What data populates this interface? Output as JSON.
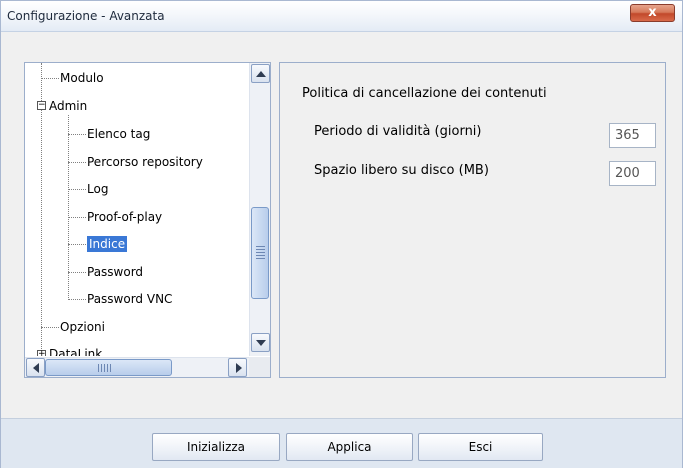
{
  "window": {
    "title": "Configurazione - Avanzata",
    "close_label": "x"
  },
  "tree": {
    "items": [
      {
        "label": "Modulo",
        "level": 1
      },
      {
        "label": "Admin",
        "level": 0,
        "expander": "−"
      },
      {
        "label": "Elenco tag",
        "level": 2
      },
      {
        "label": "Percorso repository",
        "level": 2
      },
      {
        "label": "Log",
        "level": 2
      },
      {
        "label": "Proof-of-play",
        "level": 2
      },
      {
        "label": "Indice",
        "level": 2,
        "selected": true
      },
      {
        "label": "Password",
        "level": 2
      },
      {
        "label": "Password VNC",
        "level": 2
      },
      {
        "label": "Opzioni",
        "level": 1
      },
      {
        "label": "DataLink",
        "level": 0,
        "expander": "+"
      }
    ]
  },
  "settings": {
    "section_title": "Politica di cancellazione dei contenuti",
    "fields": [
      {
        "label": "Periodo di validità (giorni)",
        "value": "365"
      },
      {
        "label": "Spazio libero su disco (MB)",
        "value": "200"
      }
    ]
  },
  "buttons": {
    "reset": "Inizializza",
    "apply": "Applica",
    "exit": "Esci"
  },
  "colors": {
    "selection": "#3a78d6",
    "close_button": "#c2492b"
  }
}
